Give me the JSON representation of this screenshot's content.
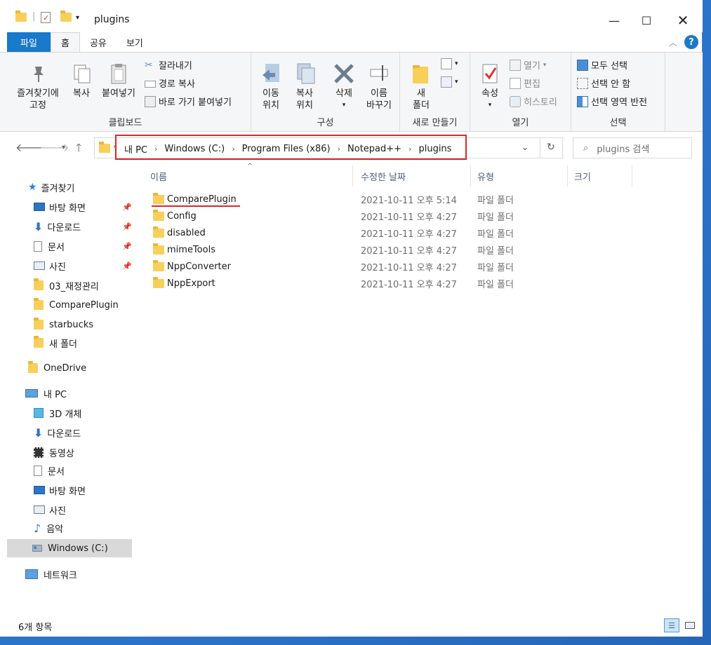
{
  "window": {
    "title": "plugins"
  },
  "tabs": {
    "file": "파일",
    "home": "홈",
    "share": "공유",
    "view": "보기"
  },
  "ribbon": {
    "clipboard": {
      "pin_label": "즐겨찾기에 고정",
      "copy_label": "복사",
      "paste_label": "붙여넣기",
      "cut_label": "잘라내기",
      "copy_path_label": "경로 복사",
      "paste_shortcut_label": "바로 가기 붙여넣기",
      "group_label": "클립보드"
    },
    "organize": {
      "move_label": "이동 위치",
      "copy_to_label": "복사 위치",
      "delete_label": "삭제",
      "rename_label": "이름 바꾸기",
      "group_label": "구성"
    },
    "new": {
      "new_folder_label": "새 폴더",
      "group_label": "새로 만들기"
    },
    "open": {
      "properties_label": "속성",
      "open_label": "열기",
      "edit_label": "편집",
      "history_label": "히스토리",
      "group_label": "열기"
    },
    "select": {
      "select_all_label": "모두 선택",
      "select_none_label": "선택 안 함",
      "invert_label": "선택 영역 반전",
      "group_label": "선택"
    }
  },
  "address": {
    "crumbs": [
      "내 PC",
      "Windows (C:)",
      "Program Files (x86)",
      "Notepad++",
      "plugins"
    ],
    "search_placeholder": "plugins 검색"
  },
  "sidebar": {
    "quick_access": "즐겨찾기",
    "quick_items": [
      "바탕 화면",
      "다운로드",
      "문서",
      "사진",
      "03_재정관리",
      "ComparePlugin",
      "starbucks",
      "새 폴더"
    ],
    "onedrive": "OneDrive",
    "this_pc": "내 PC",
    "pc_items": [
      "3D 개체",
      "다운로드",
      "동영상",
      "문서",
      "바탕 화면",
      "사진",
      "음악",
      "Windows (C:)"
    ],
    "network": "네트워크"
  },
  "columns": {
    "name": "이름",
    "date": "수정한 날짜",
    "type": "유형",
    "size": "크기"
  },
  "files": [
    {
      "name": "ComparePlugin",
      "date": "2021-10-11 오후 5:14",
      "type": "파일 폴더"
    },
    {
      "name": "Config",
      "date": "2021-10-11 오후 4:27",
      "type": "파일 폴더"
    },
    {
      "name": "disabled",
      "date": "2021-10-11 오후 4:27",
      "type": "파일 폴더"
    },
    {
      "name": "mimeTools",
      "date": "2021-10-11 오후 4:27",
      "type": "파일 폴더"
    },
    {
      "name": "NppConverter",
      "date": "2021-10-11 오후 4:27",
      "type": "파일 폴더"
    },
    {
      "name": "NppExport",
      "date": "2021-10-11 오후 4:27",
      "type": "파일 폴더"
    }
  ],
  "status": {
    "count": "6개 항목"
  },
  "colors": {
    "accent": "#1979ca",
    "highlight": "#e02424",
    "folder": "#f7cf5a"
  }
}
